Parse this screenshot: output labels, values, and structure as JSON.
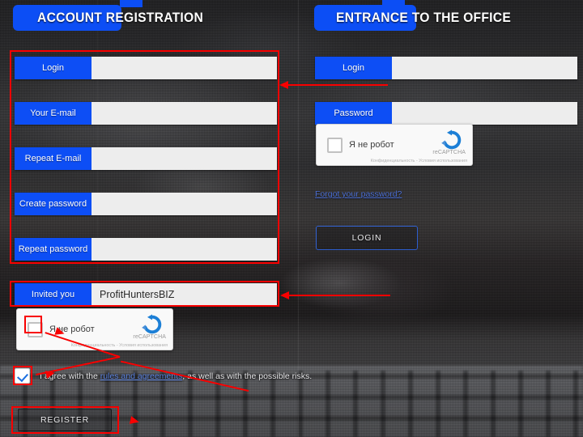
{
  "page": {
    "background_description": "blurred dark photo of laptop keyboard and desk",
    "accent_blue": "#0d4ef5",
    "annotation_red": "#f80000",
    "input_bg": "#ededed"
  },
  "left_panel": {
    "title_accent": "ACCOUNT",
    "title_rest": " REGISTRATION",
    "fields": [
      {
        "label": "Login",
        "value": "",
        "placeholder": ""
      },
      {
        "label": "Your E-mail",
        "value": "",
        "placeholder": ""
      },
      {
        "label": "Repeat E-mail",
        "value": "",
        "placeholder": ""
      },
      {
        "label": "Create password",
        "value": "",
        "placeholder": ""
      },
      {
        "label": "Repeat password",
        "value": "",
        "placeholder": ""
      }
    ],
    "referral": {
      "label": "Invited you",
      "value": "ProfitHuntersBIZ",
      "placeholder": ""
    },
    "recaptcha": {
      "label": "Я не робот",
      "brand": "reCAPTCHA",
      "fine_print": "Конфиденциальность - Условия использования",
      "checked": false
    },
    "agreement": {
      "checked": true,
      "text_before": "I agree with the ",
      "link_text": "rules and agreements",
      "text_after": ", as well as with the possible risks."
    },
    "register_button": "REGISTER"
  },
  "right_panel": {
    "title_accent": "ENTRANCE",
    "title_rest": " TO THE OFFICE",
    "fields": [
      {
        "label": "Login",
        "value": "",
        "placeholder": ""
      },
      {
        "label": "Password",
        "value": "",
        "placeholder": ""
      }
    ],
    "recaptcha": {
      "label": "Я не робот",
      "brand": "reCAPTCHA",
      "fine_print": "Конфиденциальность - Условия использования",
      "checked": false
    },
    "forgot_link": "Forgot your password?",
    "login_button": "LOGIN"
  }
}
